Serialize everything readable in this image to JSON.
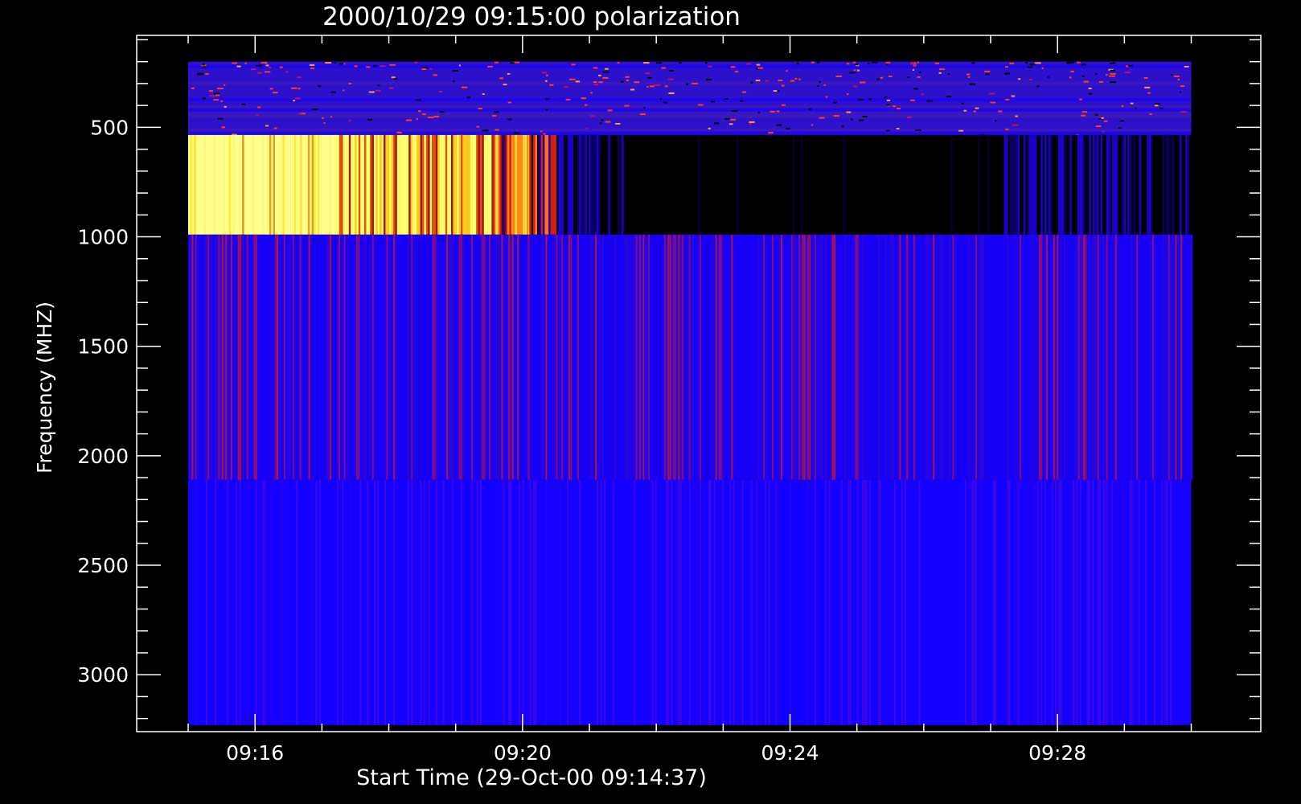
{
  "chart_data": {
    "type": "heatmap",
    "title": "2000/10/29 09:15:00 polarization",
    "xlabel": "Start Time (29-Oct-00 09:14:37)",
    "ylabel": "Frequency (MHZ)",
    "x_tick_labels": [
      "09:16",
      "09:20",
      "09:24",
      "09:28"
    ],
    "x_tick_minutes": [
      16,
      20,
      24,
      28
    ],
    "x_minor_minutes": [
      15,
      16,
      17,
      18,
      19,
      20,
      21,
      22,
      23,
      24,
      25,
      26,
      27,
      28,
      29,
      30
    ],
    "xlim_minutes": [
      14.23,
      31.04
    ],
    "data_x_range_minutes": [
      15.0,
      30.0
    ],
    "y_tick_labels": [
      "500",
      "1000",
      "1500",
      "2000",
      "2500",
      "3000"
    ],
    "y_ticks": [
      500,
      1000,
      1500,
      2000,
      2500,
      3000
    ],
    "y_minor_step": 100,
    "ylim": [
      80,
      3260
    ],
    "y_inverted": true,
    "colors": {
      "background": "#000000",
      "axes": "#ffffff",
      "low": "#1400ff",
      "mid": "#cc1a00",
      "high": "#ffff88",
      "none": "#000000"
    },
    "bands": [
      {
        "name": "band-low",
        "freq_range": [
          200,
          535
        ],
        "pattern": "noisy-speckle"
      },
      {
        "name": "band-bright",
        "freq_range": [
          535,
          990
        ],
        "pattern": "burst",
        "segments": [
          {
            "t": [
              15.0,
              17.2
            ],
            "level": "yellow"
          },
          {
            "t": [
              17.2,
              19.6
            ],
            "level": "yellow-orange"
          },
          {
            "t": [
              19.6,
              20.1
            ],
            "level": "orange"
          },
          {
            "t": [
              20.1,
              20.5
            ],
            "level": "red-orange"
          },
          {
            "t": [
              20.5,
              21.5
            ],
            "level": "blue-dark"
          },
          {
            "t": [
              21.5,
              27.2
            ],
            "level": "black"
          },
          {
            "t": [
              27.2,
              30.0
            ],
            "level": "blue-dark"
          }
        ]
      },
      {
        "name": "band-mid",
        "freq_range": [
          990,
          2110
        ],
        "pattern": "blue-red-stripes"
      },
      {
        "name": "band-high",
        "freq_range": [
          2110,
          3230
        ],
        "pattern": "blue-fine-stripes"
      }
    ]
  }
}
